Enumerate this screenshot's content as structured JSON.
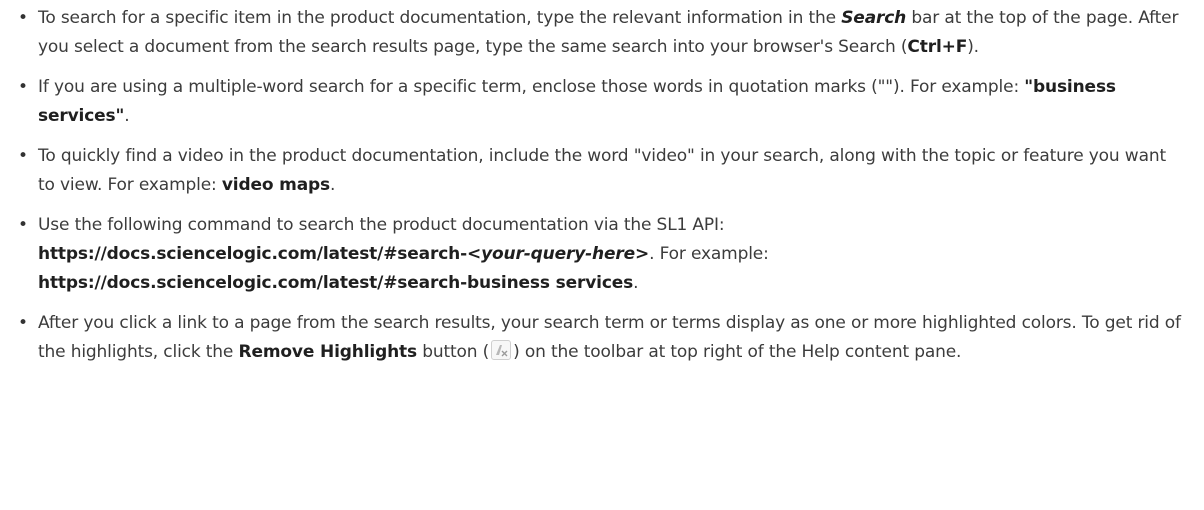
{
  "items": [
    {
      "t1": "To search for a specific item in the product documentation, type the relevant information in the ",
      "search_label": "Search",
      "t2": " bar at the top of the page. After you select a document from the search results page, type the same search into your browser's Search (",
      "shortcut": "Ctrl+F",
      "t3": ")."
    },
    {
      "t1": "If you are using a multiple-word search for a specific term, enclose those words in quotation marks (\"\"). For example: ",
      "example": "\"business services\"",
      "t2": "."
    },
    {
      "t1": "To quickly find a video in the product documentation, include the word \"video\" in your search, along with the topic or feature you want to view. For example: ",
      "example": "video maps",
      "t2": "."
    },
    {
      "t1": "Use the following command to search the product documentation via the SL1 API:",
      "url_prefix": "https://docs.sciencelogic.com/latest/#search-",
      "url_query": "<your-query-here>",
      "t2": ". For example:",
      "url_example": "https://docs.sciencelogic.com/latest/#search-business services",
      "t3": "."
    },
    {
      "t1": "After you click a link to a page from the search results, your search term or terms display as one or more highlighted colors. To get rid of the highlights, click the ",
      "button_label": "Remove Highlights",
      "t2": " button (",
      "icon": "remove-highlights-icon",
      "t3": ") on the toolbar at top right of the Help content pane."
    }
  ]
}
